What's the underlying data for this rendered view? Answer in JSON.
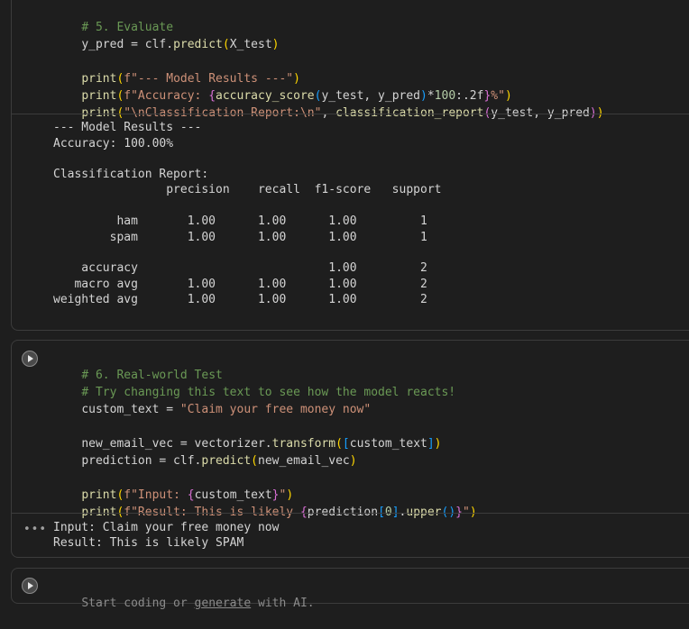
{
  "cell1": {
    "code_lines": [
      "# 5. Evaluate",
      "y_pred = clf.predict(X_test)",
      "",
      "print(f\"--- Model Results ---\")",
      "print(f\"Accuracy: {accuracy_score(y_test, y_pred)*100:.2f}%\")",
      "print(\"\\nClassification Report:\\n\", classification_report(y_test, y_pred))"
    ],
    "output_lines": [
      "--- Model Results ---",
      "Accuracy: 100.00%",
      "",
      "Classification Report:",
      "                precision    recall  f1-score   support",
      "",
      "         ham       1.00      1.00      1.00         1",
      "        spam       1.00      1.00      1.00         1",
      "",
      "    accuracy                           1.00         2",
      "   macro avg       1.00      1.00      1.00         2",
      "weighted avg       1.00      1.00      1.00         2"
    ]
  },
  "cell2": {
    "code_lines": [
      "# 6. Real-world Test",
      "# Try changing this text to see how the model reacts!",
      "custom_text = \"Claim your free money now\"",
      "",
      "new_email_vec = vectorizer.transform([custom_text])",
      "prediction = clf.predict(new_email_vec)",
      "",
      "print(f\"Input: {custom_text}\")",
      "print(f\"Result: This is likely {prediction[0].upper()}\")"
    ],
    "output_lines": [
      "Input: Claim your free money now",
      "Result: This is likely SPAM"
    ],
    "output_menu_glyph": "•••"
  },
  "empty_cell": {
    "prompt_prefix": "Start coding or ",
    "prompt_link": "generate",
    "prompt_suffix": " with AI."
  },
  "icons": {
    "run": "play-circle-icon",
    "menu": "ellipsis-icon"
  },
  "colors": {
    "background": "#1e1e1e",
    "border": "#3c3c3c",
    "comment": "#6a9955",
    "keyword": "#c586c0",
    "string": "#ce9178",
    "function": "#dcdcaa"
  }
}
